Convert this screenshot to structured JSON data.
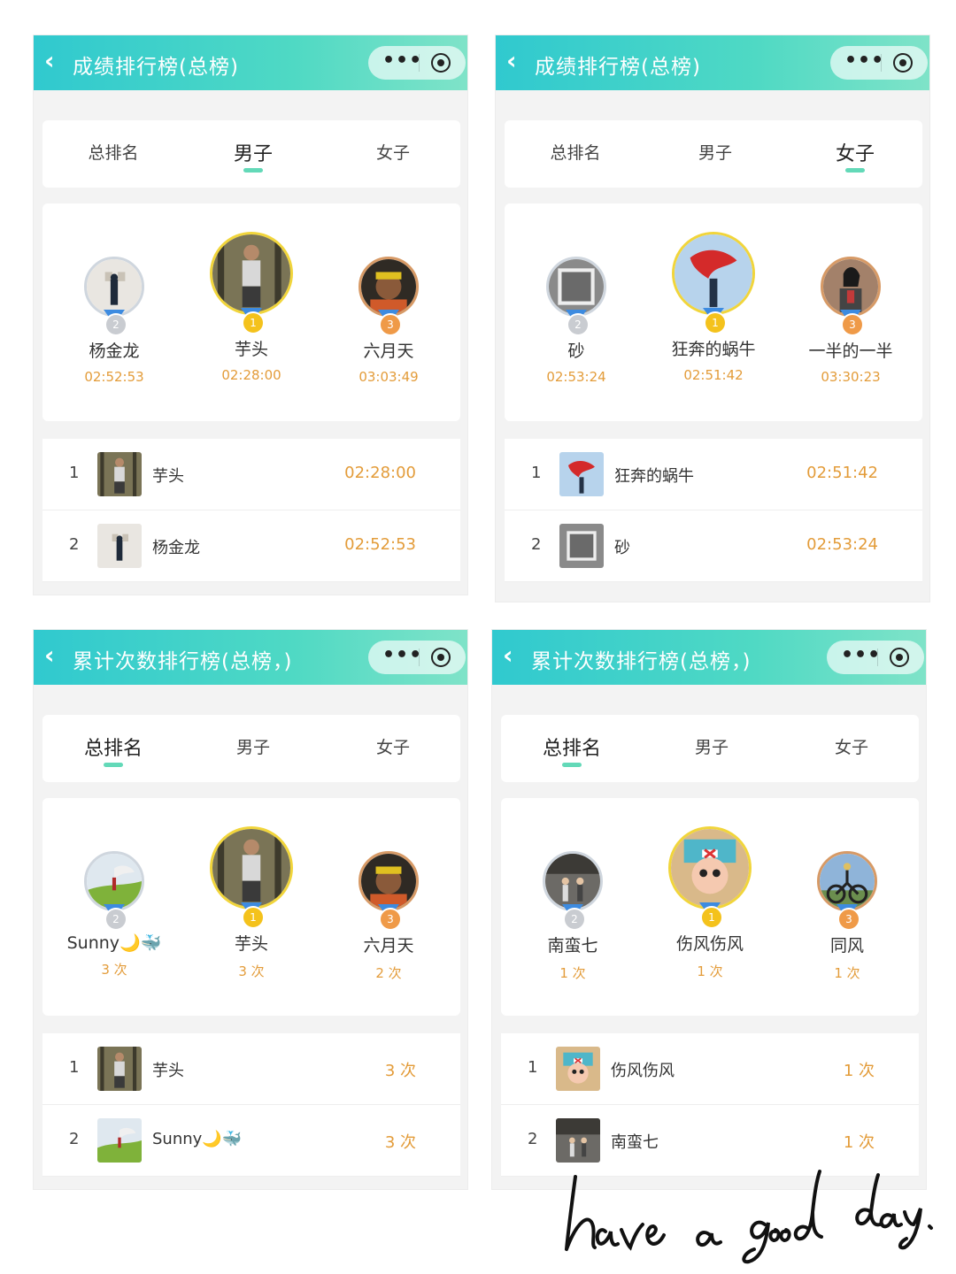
{
  "panels": [
    {
      "title": "成绩排行榜(总榜)",
      "tabs": [
        "总排名",
        "男子",
        "女子"
      ],
      "active_tab": 1,
      "podium": [
        {
          "rank": "2",
          "name": "杨金龙",
          "value": "02:52:53"
        },
        {
          "rank": "1",
          "name": "芋头",
          "value": "02:28:00"
        },
        {
          "rank": "3",
          "name": "六月天",
          "value": "03:03:49"
        }
      ],
      "list": [
        {
          "rank": "1",
          "name": "芋头",
          "value": "02:28:00"
        },
        {
          "rank": "2",
          "name": "杨金龙",
          "value": "02:52:53"
        }
      ]
    },
    {
      "title": "成绩排行榜(总榜)",
      "tabs": [
        "总排名",
        "男子",
        "女子"
      ],
      "active_tab": 2,
      "podium": [
        {
          "rank": "2",
          "name": "砂",
          "value": "02:53:24"
        },
        {
          "rank": "1",
          "name": "狂奔的蜗牛",
          "value": "02:51:42"
        },
        {
          "rank": "3",
          "name": "一半的一半",
          "value": "03:30:23"
        }
      ],
      "list": [
        {
          "rank": "1",
          "name": "狂奔的蜗牛",
          "value": "02:51:42"
        },
        {
          "rank": "2",
          "name": "砂",
          "value": "02:53:24"
        }
      ]
    },
    {
      "title": "累计次数排行榜(总榜，)",
      "tabs": [
        "总排名",
        "男子",
        "女子"
      ],
      "active_tab": 0,
      "podium": [
        {
          "rank": "2",
          "name": "Sunny🌙🐳",
          "value": "3 次"
        },
        {
          "rank": "1",
          "name": "芋头",
          "value": "3 次"
        },
        {
          "rank": "3",
          "name": "六月天",
          "value": "2 次"
        }
      ],
      "list": [
        {
          "rank": "1",
          "name": "芋头",
          "value": "3 次"
        },
        {
          "rank": "2",
          "name": "Sunny🌙🐳",
          "value": "3 次"
        }
      ]
    },
    {
      "title": "累计次数排行榜(总榜，)",
      "tabs": [
        "总排名",
        "男子",
        "女子"
      ],
      "active_tab": 0,
      "podium": [
        {
          "rank": "2",
          "name": "南蛮七",
          "value": "1 次"
        },
        {
          "rank": "1",
          "name": "伤风伤风",
          "value": "1 次"
        },
        {
          "rank": "3",
          "name": "同风",
          "value": "1 次"
        }
      ],
      "list": [
        {
          "rank": "1",
          "name": "伤风伤风",
          "value": "1 次"
        },
        {
          "rank": "2",
          "name": "南蛮七",
          "value": "1 次"
        }
      ]
    }
  ],
  "nav": {
    "back_icon": "chevron-left-icon",
    "more_icon": "more-dots-icon",
    "close_icon": "target-close-icon",
    "more_label": "•••"
  },
  "signature": "have a good day.",
  "colors": {
    "header_start": "#30c9cf",
    "header_end": "#7fe3c8",
    "accent": "#e39c3a",
    "gold": "#f4c21c",
    "silver": "#c9ccd1",
    "bronze": "#ef9a48"
  }
}
